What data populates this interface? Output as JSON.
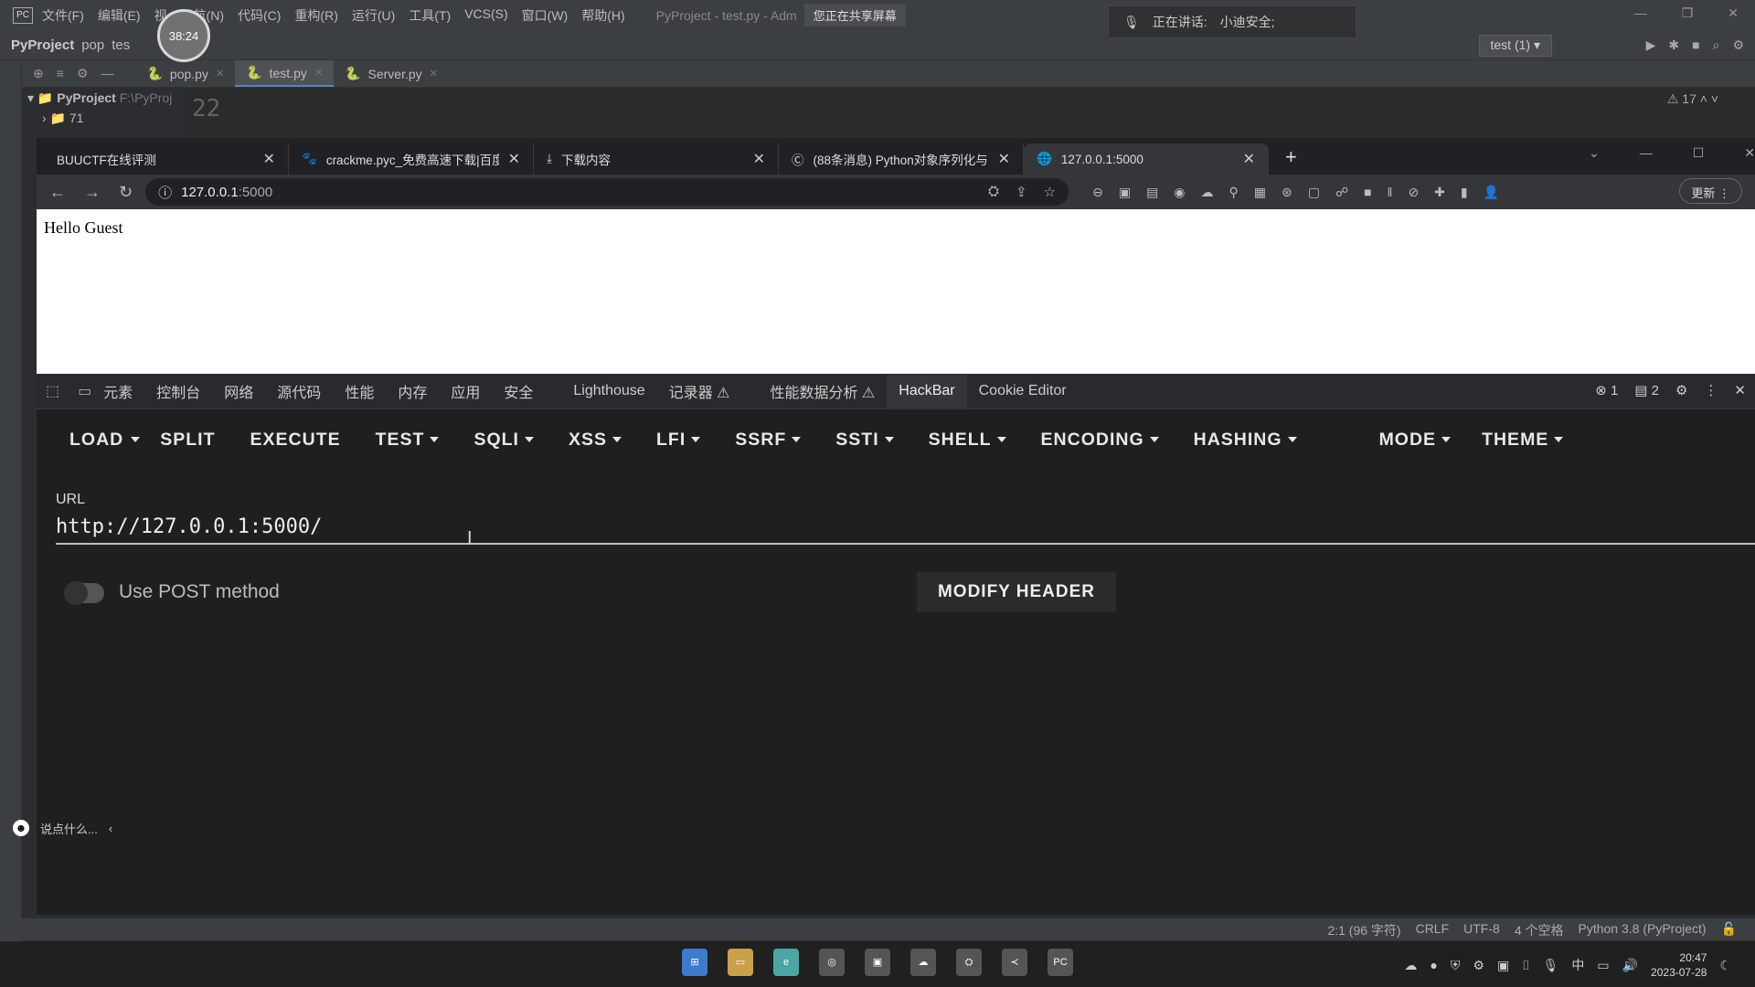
{
  "timer": "38:24",
  "ide": {
    "menu": [
      "文件(F)",
      "编辑(E)",
      "视",
      "导航(N)",
      "代码(C)",
      "重构(R)",
      "运行(U)",
      "工具(T)",
      "VCS(S)",
      "窗口(W)",
      "帮助(H)"
    ],
    "window_title": "PyProject - test.py - Adm",
    "share_notice": "您正在共享屏幕",
    "breadcrumb": {
      "project": "PyProject",
      "folder": "pop",
      "file": "tes"
    },
    "speaking": {
      "label": "正在讲话:",
      "speaker": "小迪安全;"
    },
    "run_config": "test (1)",
    "tabs": [
      {
        "label": "pop.py"
      },
      {
        "label": "test.py"
      },
      {
        "label": "Server.py"
      }
    ],
    "tree": {
      "root": "PyProject",
      "root_path": "F:\\PyProj",
      "child": "71"
    },
    "line_number": "22",
    "warnings": "17",
    "status": {
      "position": "2:1 (96 字符)",
      "line_sep": "CRLF",
      "encoding": "UTF-8",
      "indent": "4 个空格",
      "interpreter": "Python 3.8 (PyProject)"
    }
  },
  "browser": {
    "tabs": [
      {
        "label": "BUUCTF在线评测"
      },
      {
        "label": "crackme.pyc_免费高速下载|百度"
      },
      {
        "label": "下载内容"
      },
      {
        "label": "(88条消息) Python对象序列化与"
      },
      {
        "label": "127.0.0.1:5000"
      }
    ],
    "url_host": "127.0.0.1",
    "url_port": ":5000",
    "update_label": "更新",
    "page_text": "Hello Guest"
  },
  "devtools": {
    "tabs": [
      "元素",
      "控制台",
      "网络",
      "源代码",
      "性能",
      "内存",
      "应用",
      "安全",
      "Lighthouse",
      "记录器 ⚠",
      "性能数据分析 ⚠",
      "HackBar",
      "Cookie Editor"
    ],
    "active_tab": "HackBar",
    "errors": "1",
    "messages": "2"
  },
  "hackbar": {
    "menu": [
      {
        "label": "LOAD",
        "caret": false
      },
      {
        "label": "",
        "caret": true
      },
      {
        "label": "SPLIT",
        "caret": false
      },
      {
        "label": "EXECUTE",
        "caret": false
      },
      {
        "label": "TEST",
        "caret": true
      },
      {
        "label": "SQLI",
        "caret": true
      },
      {
        "label": "XSS",
        "caret": true
      },
      {
        "label": "LFI",
        "caret": true
      },
      {
        "label": "SSRF",
        "caret": true
      },
      {
        "label": "SSTI",
        "caret": true
      },
      {
        "label": "SHELL",
        "caret": true
      },
      {
        "label": "ENCODING",
        "caret": true
      },
      {
        "label": "HASHING",
        "caret": true
      },
      {
        "label": "MODE",
        "caret": true
      },
      {
        "label": "THEME",
        "caret": true
      }
    ],
    "url_label": "URL",
    "url_value": "http://127.0.0.1:5000/",
    "post_label": "Use POST method",
    "post_enabled": false,
    "modify_header": "MODIFY HEADER"
  },
  "chat": {
    "placeholder": "说点什么..."
  },
  "clock": {
    "time": "20:47",
    "date": "2023-07-28"
  },
  "tray_ime": "中"
}
